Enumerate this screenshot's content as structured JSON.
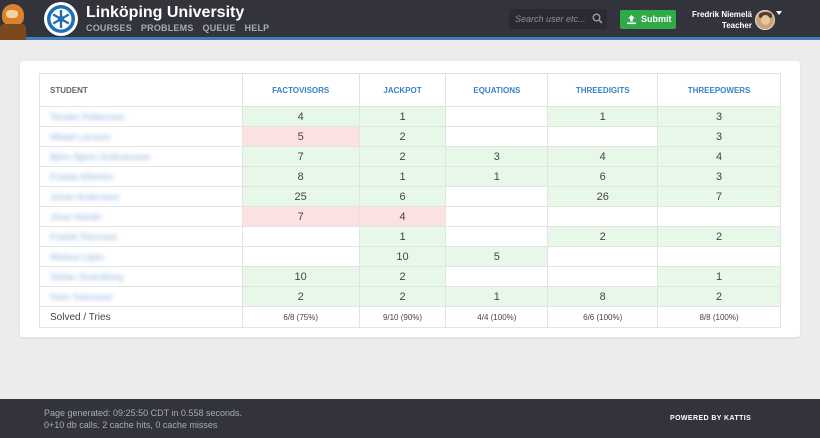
{
  "header": {
    "brand": "Linköping University",
    "nav": [
      "COURSES",
      "PROBLEMS",
      "QUEUE",
      "HELP"
    ],
    "search_placeholder": "Search user etc...",
    "submit_label": "Submit",
    "user_name": "Fredrik Niemelä",
    "user_role": "Teacher"
  },
  "table": {
    "columns": [
      "STUDENT",
      "FACTOVISORS",
      "JACKPOT",
      "EQUATIONS",
      "THREEDIGITS",
      "THREEPOWERS"
    ],
    "rows": [
      {
        "student": "Torsten Pettersson",
        "cells": [
          {
            "v": "4",
            "s": "g"
          },
          {
            "v": "1",
            "s": "g"
          },
          {
            "v": "",
            "s": ""
          },
          {
            "v": "1",
            "s": "g"
          },
          {
            "v": "3",
            "s": "g"
          }
        ]
      },
      {
        "student": "Mikael Larsson",
        "cells": [
          {
            "v": "5",
            "s": "r"
          },
          {
            "v": "2",
            "s": "g"
          },
          {
            "v": "",
            "s": ""
          },
          {
            "v": "",
            "s": ""
          },
          {
            "v": "3",
            "s": "g"
          }
        ]
      },
      {
        "student": "Björn Ågren Gullmarsson",
        "cells": [
          {
            "v": "7",
            "s": "g"
          },
          {
            "v": "2",
            "s": "g"
          },
          {
            "v": "3",
            "s": "g"
          },
          {
            "v": "4",
            "s": "g"
          },
          {
            "v": "4",
            "s": "g"
          }
        ]
      },
      {
        "student": "Franke Elfström",
        "cells": [
          {
            "v": "8",
            "s": "g"
          },
          {
            "v": "1",
            "s": "g"
          },
          {
            "v": "1",
            "s": "g"
          },
          {
            "v": "6",
            "s": "g"
          },
          {
            "v": "3",
            "s": "g"
          }
        ]
      },
      {
        "student": "Johan Andersson",
        "cells": [
          {
            "v": "25",
            "s": "g"
          },
          {
            "v": "6",
            "s": "g"
          },
          {
            "v": "",
            "s": ""
          },
          {
            "v": "26",
            "s": "g"
          },
          {
            "v": "7",
            "s": "g"
          }
        ]
      },
      {
        "student": "Jöran Nordin",
        "cells": [
          {
            "v": "7",
            "s": "r"
          },
          {
            "v": "4",
            "s": "r"
          },
          {
            "v": "",
            "s": ""
          },
          {
            "v": "",
            "s": ""
          },
          {
            "v": "",
            "s": ""
          }
        ]
      },
      {
        "student": "Fredrik Renmark",
        "cells": [
          {
            "v": "",
            "s": ""
          },
          {
            "v": "1",
            "s": "g"
          },
          {
            "v": "",
            "s": ""
          },
          {
            "v": "2",
            "s": "g"
          },
          {
            "v": "2",
            "s": "g"
          }
        ]
      },
      {
        "student": "Markus Lejon",
        "cells": [
          {
            "v": "",
            "s": ""
          },
          {
            "v": "10",
            "s": "g"
          },
          {
            "v": "5",
            "s": "g"
          },
          {
            "v": "",
            "s": ""
          },
          {
            "v": "",
            "s": ""
          }
        ]
      },
      {
        "student": "Stefan Strandberg",
        "cells": [
          {
            "v": "10",
            "s": "g"
          },
          {
            "v": "2",
            "s": "g"
          },
          {
            "v": "",
            "s": ""
          },
          {
            "v": "",
            "s": ""
          },
          {
            "v": "1",
            "s": "g"
          }
        ]
      },
      {
        "student": "Sven Svensson",
        "cells": [
          {
            "v": "2",
            "s": "g"
          },
          {
            "v": "2",
            "s": "g"
          },
          {
            "v": "1",
            "s": "g"
          },
          {
            "v": "8",
            "s": "g"
          },
          {
            "v": "2",
            "s": "g"
          }
        ]
      }
    ],
    "summary_label": "Solved / Tries",
    "summary": [
      "6/8 (75%)",
      "9/10 (90%)",
      "4/4 (100%)",
      "6/6 (100%)",
      "8/8 (100%)"
    ]
  },
  "footer": {
    "line1": "Page generated: 09:25:50 CDT in 0.558 seconds.",
    "line2": "0+10 db calls. 2 cache hits, 0 cache misses",
    "powered": "POWERED BY KATTIS"
  },
  "colors": {
    "header_bg": "#33343b",
    "accent_blue": "#3e7dc0",
    "solved_green": "#e8f8e8",
    "failed_red": "#fbe1e1",
    "submit_green": "#2fa94a"
  },
  "icons": [
    "kattis-mascot",
    "university-logo-icon",
    "search-icon",
    "upload-icon",
    "avatar",
    "caret-down-icon"
  ]
}
